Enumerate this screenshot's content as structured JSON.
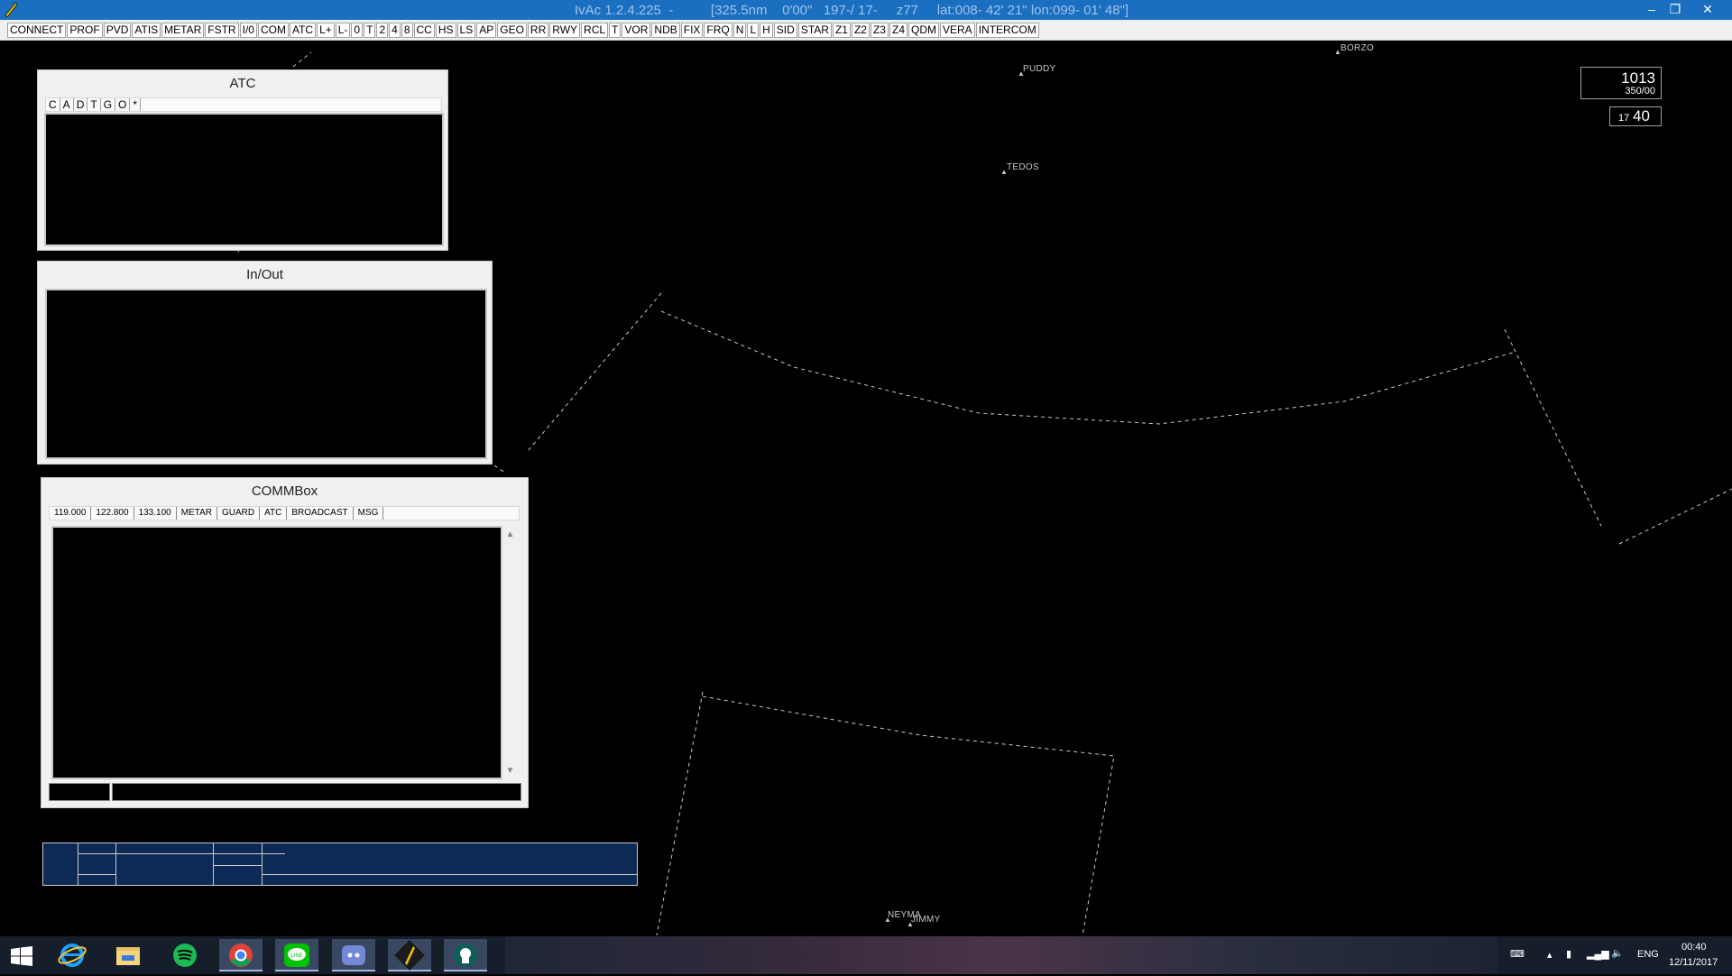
{
  "window": {
    "title": "IvAc 1.2.4.225  -          [325.5nm    0'00\"   197-/ 17-     z77     lat:008- 42' 21\" lon:099- 01' 48\"]",
    "controls": [
      "–",
      "❐",
      "✕"
    ]
  },
  "toolbar": {
    "buttons": [
      "CONNECT",
      "PROF",
      "PVD",
      "ATIS",
      "METAR",
      "FSTR",
      "I/0",
      "COM",
      "ATC",
      "L+",
      "L-",
      "0",
      "T",
      "2",
      "4",
      "8",
      "CC",
      "HS",
      "LS",
      "AP",
      "GEO",
      "RR",
      "RWY",
      "RCL",
      "T",
      "VOR",
      "NDB",
      "FIX",
      "FRQ",
      "N",
      "L",
      "H",
      "SID",
      "STAR",
      "Z1",
      "Z2",
      "Z3",
      "Z4",
      "QDM",
      "VERA",
      "INTERCOM"
    ]
  },
  "scope": {
    "fixes": [
      {
        "name": "BORZO"
      },
      {
        "name": "PUDDY"
      },
      {
        "name": "TEDOS"
      },
      {
        "name": "NEYMA"
      },
      {
        "name": "JIMMY"
      }
    ],
    "qnh": "1013",
    "transition": "350/00",
    "clock_hour": "17",
    "clock_min": "40"
  },
  "atc_panel": {
    "title": "ATC",
    "filters": [
      "C",
      "A",
      "D",
      "T",
      "G",
      "O",
      "*"
    ]
  },
  "inout_panel": {
    "title": "In/Out"
  },
  "comm_panel": {
    "title": "COMMBox",
    "tabs": [
      "119.000",
      "122.800",
      "133.100",
      "METAR",
      "GUARD",
      "ATC",
      "BROADCAST",
      "MSG"
    ]
  },
  "taskbar": {
    "apps": [
      "start-icon",
      "internet-explorer-icon",
      "file-explorer-icon",
      "spotify-icon",
      "chrome-icon",
      "line-icon",
      "discord-icon",
      "ivac-icon",
      "gitkraken-icon"
    ],
    "language": "ENG",
    "time": "00:40",
    "date": "12/11/2017"
  },
  "colors": {
    "titlebar": "#1b6fc0",
    "scope_bg": "#000000",
    "strip_bg": "#0d2a57",
    "sector_line": "#c8c8c8"
  }
}
